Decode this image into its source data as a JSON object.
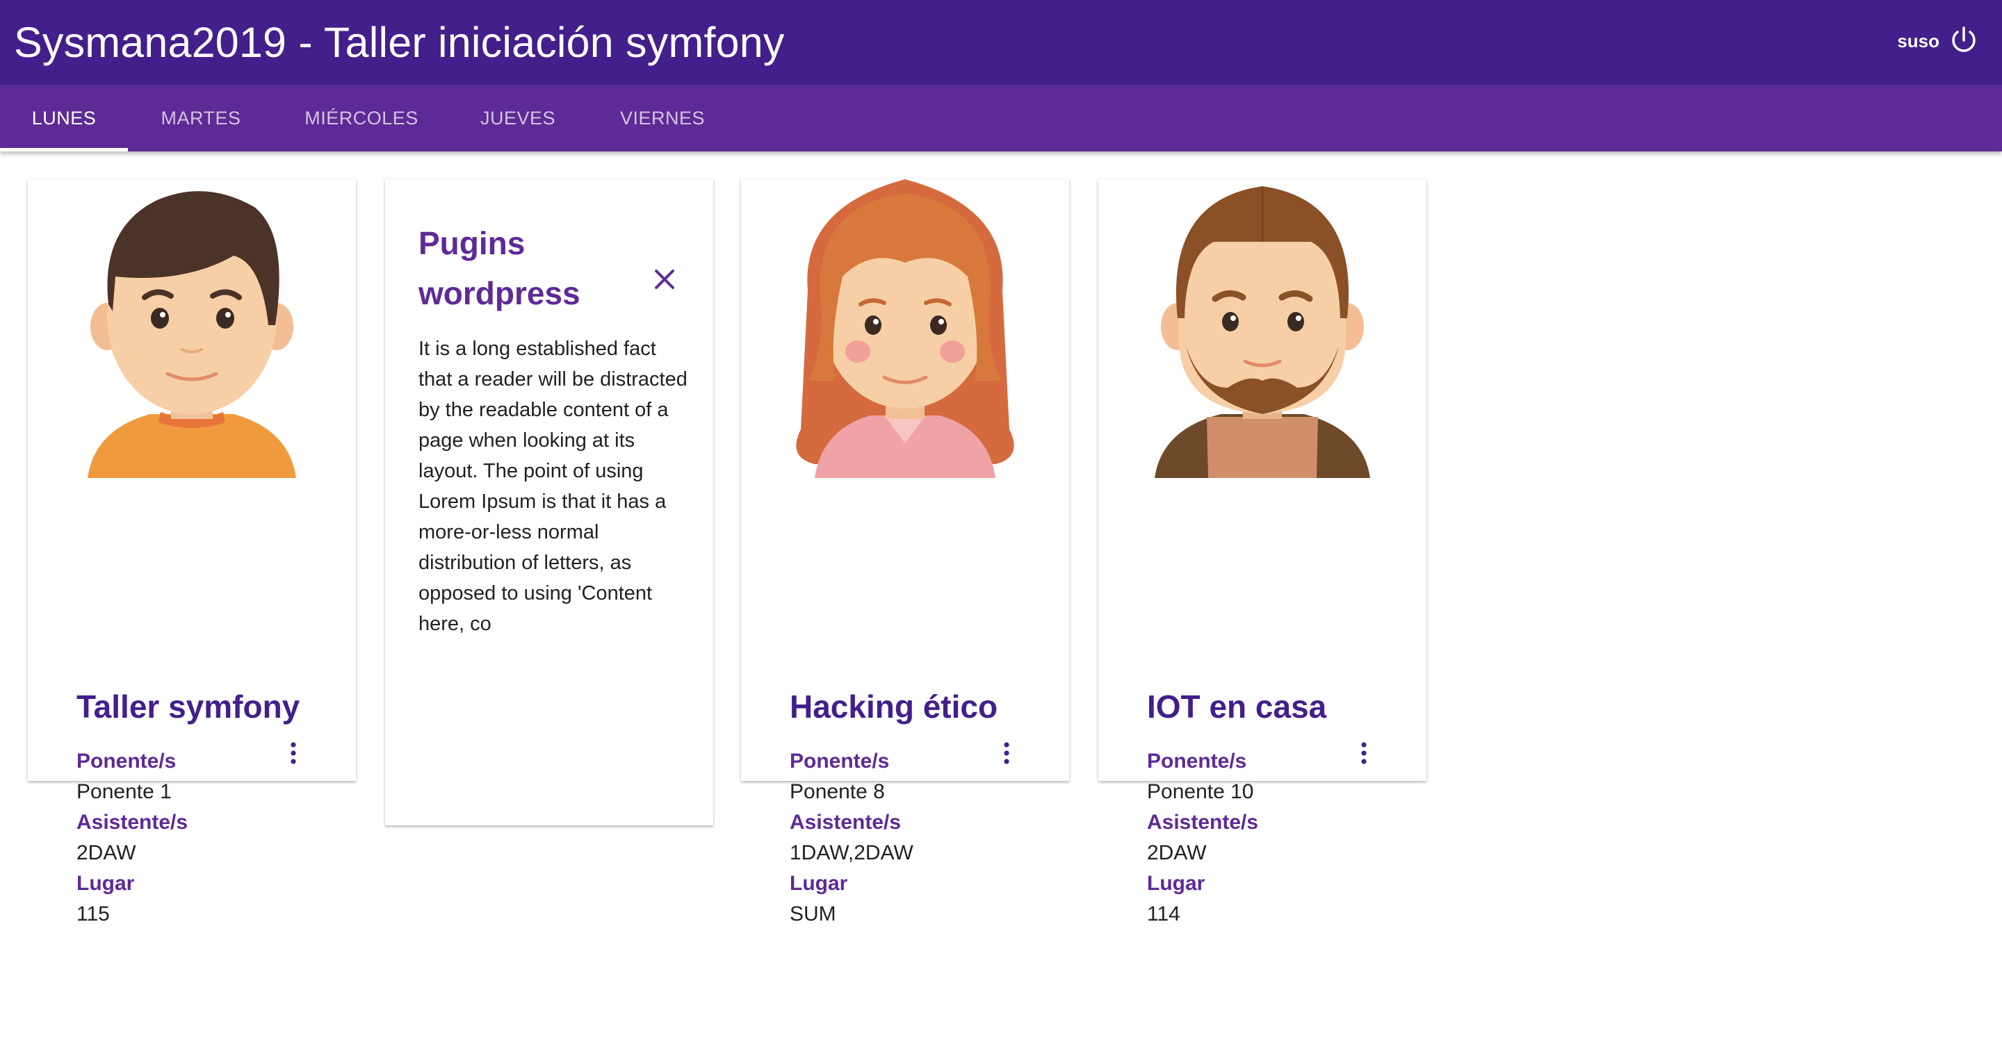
{
  "app": {
    "title": "Sysmana2019 - Taller iniciación symfony",
    "user": "suso",
    "power_icon": "power-icon"
  },
  "tabs": [
    {
      "label": "LUNES",
      "active": true
    },
    {
      "label": "MARTES",
      "active": false
    },
    {
      "label": "MIÉRCOLES",
      "active": false
    },
    {
      "label": "JUEVES",
      "active": false
    },
    {
      "label": "VIERNES",
      "active": false
    }
  ],
  "labels": {
    "speaker": "Ponente/s",
    "attendees": "Asistente/s",
    "place": "Lugar"
  },
  "cards": [
    {
      "title": "Taller symfony",
      "speaker": "Ponente 1",
      "attendees": "2DAW",
      "place": "115",
      "avatar": "boy-avatar"
    },
    {
      "title": "Pugins wordpress",
      "description": "It is a long established fact that a reader will be distracted by the readable content of a page when looking at its layout. The point of using Lorem Ipsum is that it has a more-or-less normal distribution of letters, as opposed to using 'Content here, co",
      "revealed": true
    },
    {
      "title": "Hacking ético",
      "speaker": "Ponente 8",
      "attendees": "1DAW,2DAW",
      "place": "SUM",
      "avatar": "girl-avatar"
    },
    {
      "title": "IOT en casa",
      "speaker": "Ponente 10",
      "attendees": "2DAW",
      "place": "114",
      "avatar": "bearded-man-avatar"
    }
  ],
  "colors": {
    "appbar": "#421f8a",
    "tabs": "#5e2a96",
    "accent": "#5e2a96"
  }
}
